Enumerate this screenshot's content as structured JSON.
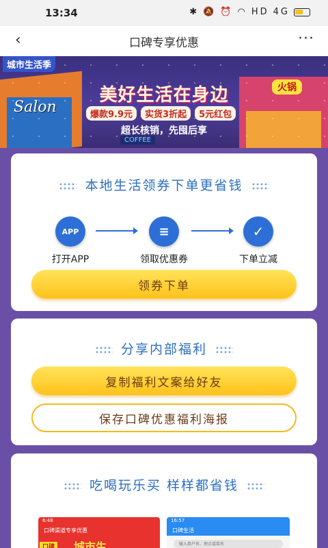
{
  "status_bar": {
    "time": "13:34",
    "icons": [
      "bluetooth-icon",
      "mute-icon",
      "alarm-icon",
      "wifi-icon",
      "hd-signal-icon",
      "battery-icon"
    ],
    "network_label": "HD",
    "signal_label": "4G"
  },
  "nav": {
    "title": "口碑专享优惠",
    "back_glyph": "‹",
    "more_glyph": "···"
  },
  "banner": {
    "brand": "城市生活季",
    "headline": "美好生活在身边",
    "chips": [
      "爆款9.9元",
      "实货3折起",
      "5元红包"
    ],
    "subline": "超长核销，先囤后享",
    "shop_sign_left": "Salon",
    "shop_sign_right": "火锅",
    "shop_sign_coffee": "COFFEE"
  },
  "card_coupon": {
    "title": "本地生活领券下单更省钱",
    "steps": [
      {
        "icon_text": "APP",
        "label": "打开APP"
      },
      {
        "icon_text": "≡",
        "label": "领取优惠券"
      },
      {
        "icon_text": "✓",
        "label": "下单立减"
      }
    ],
    "button": "领券下单"
  },
  "card_share": {
    "title": "分享内部福利",
    "button_copy": "复制福利文案给好友",
    "button_save": "保存口碑优惠福利海报"
  },
  "card_save": {
    "title": "吃喝玩乐买 样样都省钱",
    "shot_left": {
      "time": "6:48",
      "title": "口碑渠道专享优惠",
      "brand": "口碑",
      "promo": "城市生"
    },
    "shot_right": {
      "time": "16:57",
      "title": "口碑生活",
      "search": "输入商户名、地点或菜名"
    }
  },
  "colors": {
    "page_bg": "#6a4fa6",
    "accent_blue": "#2d6fd6",
    "title_blue": "#2b6ec0",
    "button_yellow": "#ffc21a",
    "button_text": "#6b3a13"
  }
}
